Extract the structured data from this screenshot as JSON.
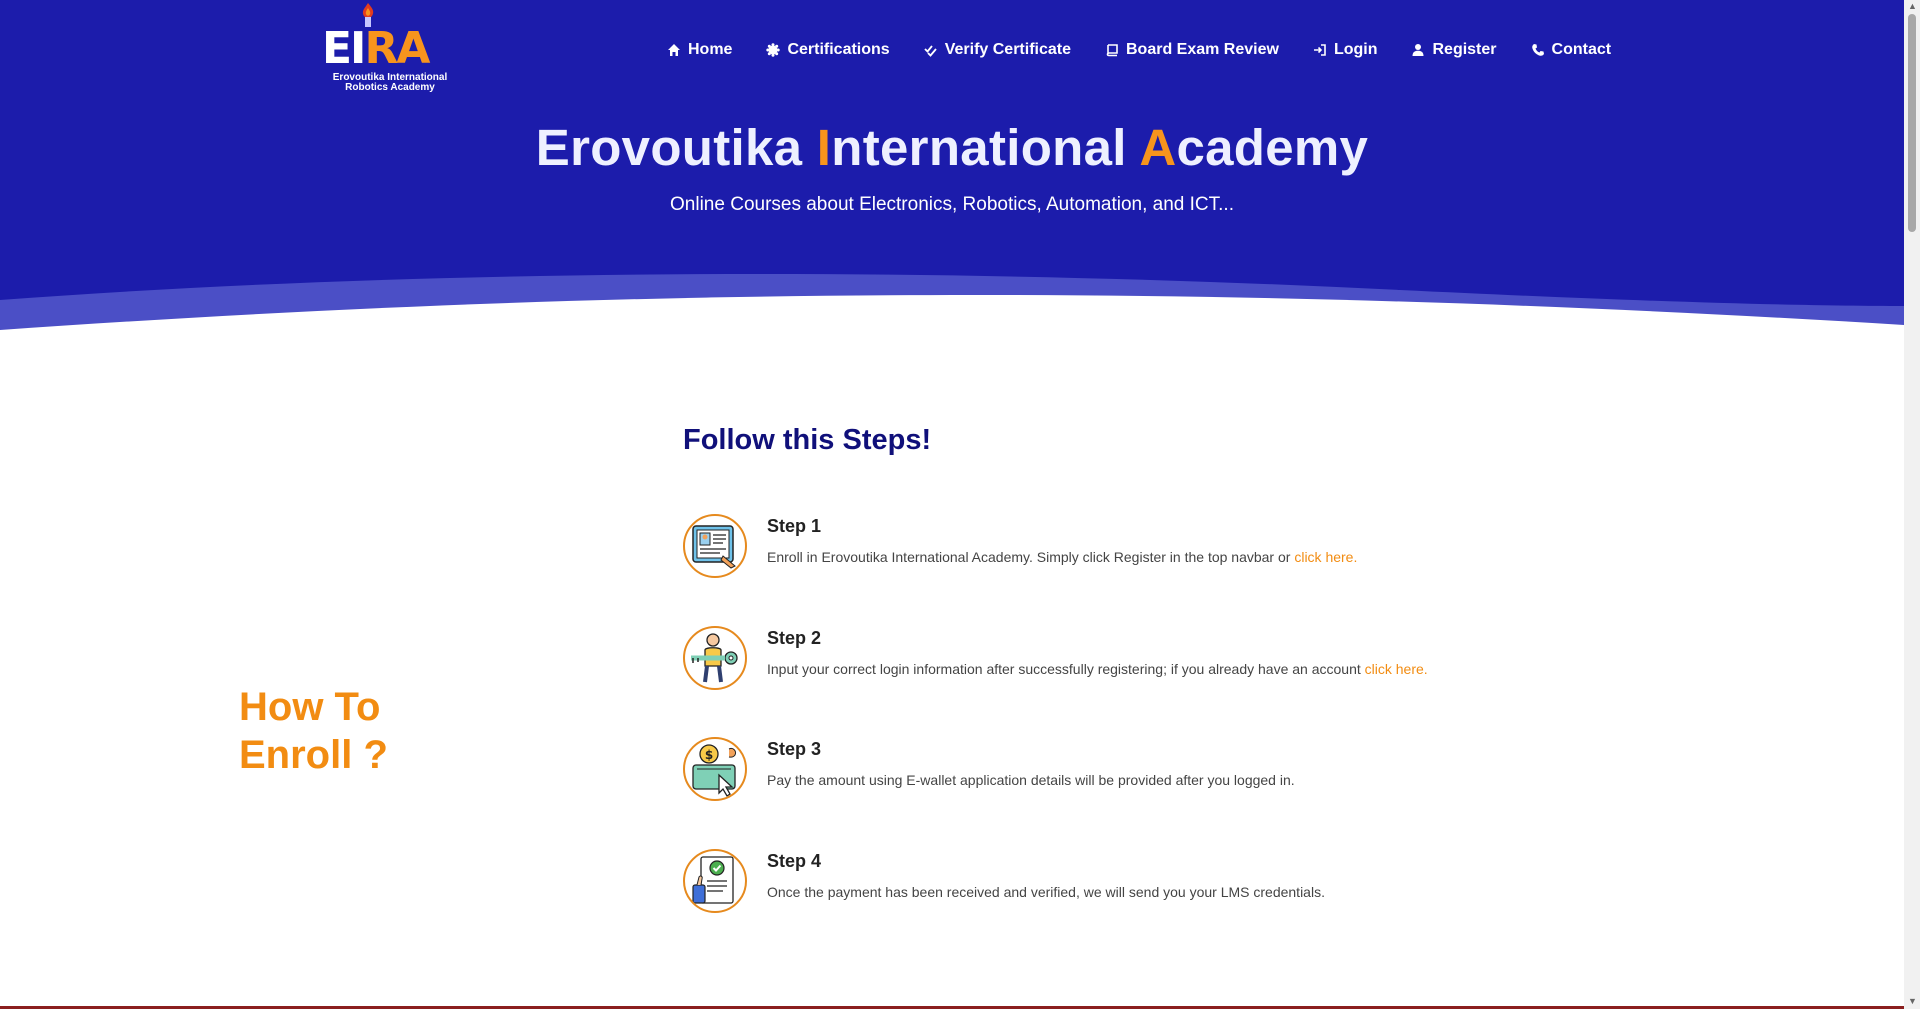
{
  "logo": {
    "letters_left": "EI",
    "letters_right": "RA",
    "caption_line1": "Erovoutika International",
    "caption_line2": "Robotics Academy"
  },
  "nav": [
    {
      "label": "Home",
      "icon": "home-icon"
    },
    {
      "label": "Certifications",
      "icon": "badge-icon"
    },
    {
      "label": "Verify Certificate",
      "icon": "double-check-icon"
    },
    {
      "label": "Board Exam Review",
      "icon": "book-icon"
    },
    {
      "label": "Login",
      "icon": "sign-in-icon"
    },
    {
      "label": "Register",
      "icon": "user-icon"
    },
    {
      "label": "Contact",
      "icon": "phone-icon"
    }
  ],
  "hero": {
    "title_part1": "Erovoutika ",
    "title_hl1": "I",
    "title_part2": "nternational ",
    "title_hl2": "A",
    "title_part3": "cademy",
    "subtitle": "Online Courses about Electronics, Robotics, Automation, and ICT..."
  },
  "side_title": {
    "line1": "How To",
    "line2": "Enroll ?"
  },
  "steps_heading": "Follow this Steps!",
  "steps": [
    {
      "title": "Step 1",
      "text": "Enroll in Erovoutika International Academy. Simply click Register in the top navbar or ",
      "link": "click here.",
      "icon": "registration-form-icon"
    },
    {
      "title": "Step 2",
      "text": "Input your correct login information after successfully registering; if you already have an account ",
      "link": "click here.",
      "icon": "person-with-key-icon"
    },
    {
      "title": "Step 3",
      "text": "Pay the amount using E-wallet application details will be provided after you logged in.",
      "link": "",
      "icon": "online-payment-icon"
    },
    {
      "title": "Step 4",
      "text": "Once the payment has been received and verified, we will send you your LMS credentials.",
      "link": "",
      "icon": "approved-document-icon"
    }
  ],
  "colors": {
    "hero_bg": "#1c1cab",
    "accent": "#f28c12",
    "heading": "#10107a"
  }
}
